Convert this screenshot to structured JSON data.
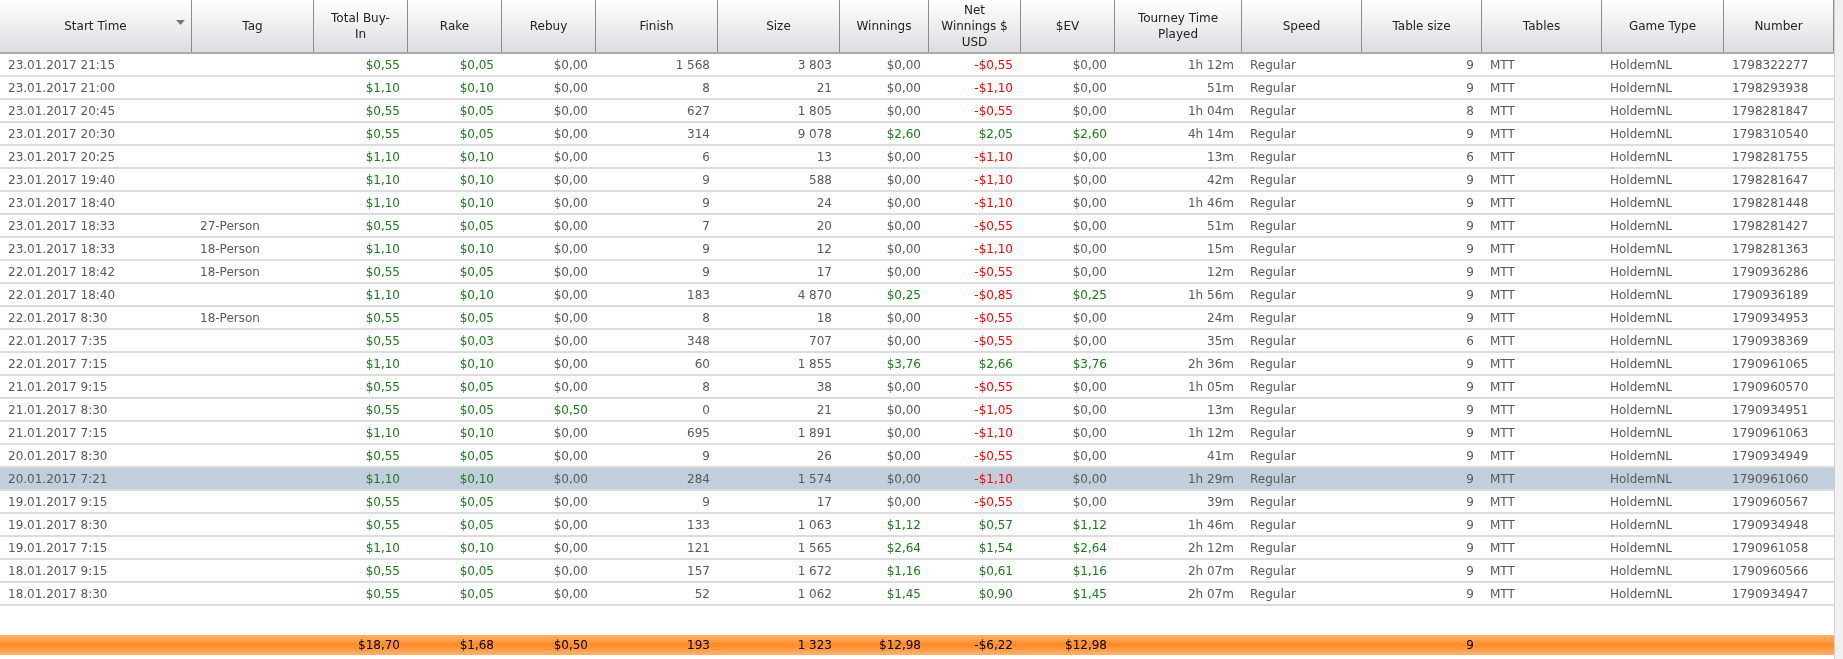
{
  "columns": [
    {
      "label": "Start Time",
      "sorted": true
    },
    {
      "label": "Tag",
      "sorted": false
    },
    {
      "label": "Total Buy-In",
      "sorted": false
    },
    {
      "label": "Rake",
      "sorted": false
    },
    {
      "label": "Rebuy",
      "sorted": false
    },
    {
      "label": "Finish",
      "sorted": false
    },
    {
      "label": "Size",
      "sorted": false
    },
    {
      "label": "Winnings",
      "sorted": false
    },
    {
      "label": "Net Winnings $ USD",
      "sorted": false
    },
    {
      "label": "$EV",
      "sorted": false
    },
    {
      "label": "Tourney Time Played",
      "sorted": false
    },
    {
      "label": "Speed",
      "sorted": false
    },
    {
      "label": "Table size",
      "sorted": false
    },
    {
      "label": "Tables",
      "sorted": false
    },
    {
      "label": "Game Type",
      "sorted": false
    },
    {
      "label": "Number",
      "sorted": false
    }
  ],
  "rows": [
    {
      "selected": false,
      "start_time": "23.01.2017 21:15",
      "buy_in": {
        "text": "$0,55",
        "color": "#1a7a1a"
      },
      "rake": {
        "text": "$0,05",
        "color": "#1a7a1a"
      },
      "rebuy": {
        "text": "$0,00",
        "color": "#595959"
      },
      "finish": "1 568",
      "size": "3 803",
      "winnings": {
        "text": "$0,00",
        "color": "#595959"
      },
      "net_winnings": {
        "text": "-$0,55",
        "color": "#ff0000"
      },
      "ev": {
        "text": "$0,00",
        "color": "#595959"
      },
      "time_played": "1h 12m",
      "speed": "Regular",
      "table_size": "9",
      "tables": "MTT",
      "game_type": "HoldemNL",
      "number": "1798322277"
    },
    {
      "selected": false,
      "start_time": "23.01.2017 21:00",
      "buy_in": {
        "text": "$1,10",
        "color": "#1a7a1a"
      },
      "rake": {
        "text": "$0,10",
        "color": "#1a7a1a"
      },
      "rebuy": {
        "text": "$0,00",
        "color": "#595959"
      },
      "finish": "8",
      "size": "21",
      "winnings": {
        "text": "$0,00",
        "color": "#595959"
      },
      "net_winnings": {
        "text": "-$1,10",
        "color": "#ff0000"
      },
      "ev": {
        "text": "$0,00",
        "color": "#595959"
      },
      "time_played": "51m",
      "speed": "Regular",
      "table_size": "9",
      "tables": "MTT",
      "game_type": "HoldemNL",
      "number": "1798293938"
    },
    {
      "selected": false,
      "start_time": "23.01.2017 20:45",
      "buy_in": {
        "text": "$0,55",
        "color": "#1a7a1a"
      },
      "rake": {
        "text": "$0,05",
        "color": "#1a7a1a"
      },
      "rebuy": {
        "text": "$0,00",
        "color": "#595959"
      },
      "finish": "627",
      "size": "1 805",
      "winnings": {
        "text": "$0,00",
        "color": "#595959"
      },
      "net_winnings": {
        "text": "-$0,55",
        "color": "#ff0000"
      },
      "ev": {
        "text": "$0,00",
        "color": "#595959"
      },
      "time_played": "1h 04m",
      "speed": "Regular",
      "table_size": "8",
      "tables": "MTT",
      "game_type": "HoldemNL",
      "number": "1798281847"
    },
    {
      "selected": false,
      "start_time": "23.01.2017 20:30",
      "buy_in": {
        "text": "$0,55",
        "color": "#1a7a1a"
      },
      "rake": {
        "text": "$0,05",
        "color": "#1a7a1a"
      },
      "rebuy": {
        "text": "$0,00",
        "color": "#595959"
      },
      "finish": "314",
      "size": "9 078",
      "winnings": {
        "text": "$2,60",
        "color": "#1a7a1a"
      },
      "net_winnings": {
        "text": "$2,05",
        "color": "#1a7a1a"
      },
      "ev": {
        "text": "$2,60",
        "color": "#1a7a1a"
      },
      "time_played": "4h 14m",
      "speed": "Regular",
      "table_size": "9",
      "tables": "MTT",
      "game_type": "HoldemNL",
      "number": "1798310540"
    },
    {
      "selected": false,
      "start_time": "23.01.2017 20:25",
      "buy_in": {
        "text": "$1,10",
        "color": "#1a7a1a"
      },
      "rake": {
        "text": "$0,10",
        "color": "#1a7a1a"
      },
      "rebuy": {
        "text": "$0,00",
        "color": "#595959"
      },
      "finish": "6",
      "size": "13",
      "winnings": {
        "text": "$0,00",
        "color": "#595959"
      },
      "net_winnings": {
        "text": "-$1,10",
        "color": "#ff0000"
      },
      "ev": {
        "text": "$0,00",
        "color": "#595959"
      },
      "time_played": "13m",
      "speed": "Regular",
      "table_size": "6",
      "tables": "MTT",
      "game_type": "HoldemNL",
      "number": "1798281755"
    },
    {
      "selected": false,
      "start_time": "23.01.2017 19:40",
      "buy_in": {
        "text": "$1,10",
        "color": "#1a7a1a"
      },
      "rake": {
        "text": "$0,10",
        "color": "#1a7a1a"
      },
      "rebuy": {
        "text": "$0,00",
        "color": "#595959"
      },
      "finish": "9",
      "size": "588",
      "winnings": {
        "text": "$0,00",
        "color": "#595959"
      },
      "net_winnings": {
        "text": "-$1,10",
        "color": "#ff0000"
      },
      "ev": {
        "text": "$0,00",
        "color": "#595959"
      },
      "time_played": "42m",
      "speed": "Regular",
      "table_size": "9",
      "tables": "MTT",
      "game_type": "HoldemNL",
      "number": "1798281647"
    },
    {
      "selected": false,
      "start_time": "23.01.2017 18:40",
      "buy_in": {
        "text": "$1,10",
        "color": "#1a7a1a"
      },
      "rake": {
        "text": "$0,10",
        "color": "#1a7a1a"
      },
      "rebuy": {
        "text": "$0,00",
        "color": "#595959"
      },
      "finish": "9",
      "size": "24",
      "winnings": {
        "text": "$0,00",
        "color": "#595959"
      },
      "net_winnings": {
        "text": "-$1,10",
        "color": "#ff0000"
      },
      "ev": {
        "text": "$0,00",
        "color": "#595959"
      },
      "time_played": "1h 46m",
      "speed": "Regular",
      "table_size": "9",
      "tables": "MTT",
      "game_type": "HoldemNL",
      "number": "1798281448"
    },
    {
      "selected": false,
      "start_time": "23.01.2017 18:33",
      "tag": "27-Person",
      "buy_in": {
        "text": "$0,55",
        "color": "#1a7a1a"
      },
      "rake": {
        "text": "$0,05",
        "color": "#1a7a1a"
      },
      "rebuy": {
        "text": "$0,00",
        "color": "#595959"
      },
      "finish": "7",
      "size": "20",
      "winnings": {
        "text": "$0,00",
        "color": "#595959"
      },
      "net_winnings": {
        "text": "-$0,55",
        "color": "#ff0000"
      },
      "ev": {
        "text": "$0,00",
        "color": "#595959"
      },
      "time_played": "51m",
      "speed": "Regular",
      "table_size": "9",
      "tables": "MTT",
      "game_type": "HoldemNL",
      "number": "1798281427"
    },
    {
      "selected": false,
      "start_time": "23.01.2017 18:33",
      "tag": "18-Person",
      "buy_in": {
        "text": "$1,10",
        "color": "#1a7a1a"
      },
      "rake": {
        "text": "$0,10",
        "color": "#1a7a1a"
      },
      "rebuy": {
        "text": "$0,00",
        "color": "#595959"
      },
      "finish": "9",
      "size": "12",
      "winnings": {
        "text": "$0,00",
        "color": "#595959"
      },
      "net_winnings": {
        "text": "-$1,10",
        "color": "#ff0000"
      },
      "ev": {
        "text": "$0,00",
        "color": "#595959"
      },
      "time_played": "15m",
      "speed": "Regular",
      "table_size": "9",
      "tables": "MTT",
      "game_type": "HoldemNL",
      "number": "1798281363"
    },
    {
      "selected": false,
      "start_time": "22.01.2017 18:42",
      "tag": "18-Person",
      "buy_in": {
        "text": "$0,55",
        "color": "#1a7a1a"
      },
      "rake": {
        "text": "$0,05",
        "color": "#1a7a1a"
      },
      "rebuy": {
        "text": "$0,00",
        "color": "#595959"
      },
      "finish": "9",
      "size": "17",
      "winnings": {
        "text": "$0,00",
        "color": "#595959"
      },
      "net_winnings": {
        "text": "-$0,55",
        "color": "#ff0000"
      },
      "ev": {
        "text": "$0,00",
        "color": "#595959"
      },
      "time_played": "12m",
      "speed": "Regular",
      "table_size": "9",
      "tables": "MTT",
      "game_type": "HoldemNL",
      "number": "1790936286"
    },
    {
      "selected": false,
      "start_time": "22.01.2017 18:40",
      "buy_in": {
        "text": "$1,10",
        "color": "#1a7a1a"
      },
      "rake": {
        "text": "$0,10",
        "color": "#1a7a1a"
      },
      "rebuy": {
        "text": "$0,00",
        "color": "#595959"
      },
      "finish": "183",
      "size": "4 870",
      "winnings": {
        "text": "$0,25",
        "color": "#1a7a1a"
      },
      "net_winnings": {
        "text": "-$0,85",
        "color": "#ff0000"
      },
      "ev": {
        "text": "$0,25",
        "color": "#1a7a1a"
      },
      "time_played": "1h 56m",
      "speed": "Regular",
      "table_size": "9",
      "tables": "MTT",
      "game_type": "HoldemNL",
      "number": "1790936189"
    },
    {
      "selected": false,
      "start_time": "22.01.2017 8:30",
      "tag": "18-Person",
      "buy_in": {
        "text": "$0,55",
        "color": "#1a7a1a"
      },
      "rake": {
        "text": "$0,05",
        "color": "#1a7a1a"
      },
      "rebuy": {
        "text": "$0,00",
        "color": "#595959"
      },
      "finish": "8",
      "size": "18",
      "winnings": {
        "text": "$0,00",
        "color": "#595959"
      },
      "net_winnings": {
        "text": "-$0,55",
        "color": "#ff0000"
      },
      "ev": {
        "text": "$0,00",
        "color": "#595959"
      },
      "time_played": "24m",
      "speed": "Regular",
      "table_size": "9",
      "tables": "MTT",
      "game_type": "HoldemNL",
      "number": "1790934953"
    },
    {
      "selected": false,
      "start_time": "22.01.2017 7:35",
      "buy_in": {
        "text": "$0,55",
        "color": "#1a7a1a"
      },
      "rake": {
        "text": "$0,03",
        "color": "#1a7a1a"
      },
      "rebuy": {
        "text": "$0,00",
        "color": "#595959"
      },
      "finish": "348",
      "size": "707",
      "winnings": {
        "text": "$0,00",
        "color": "#595959"
      },
      "net_winnings": {
        "text": "-$0,55",
        "color": "#ff0000"
      },
      "ev": {
        "text": "$0,00",
        "color": "#595959"
      },
      "time_played": "35m",
      "speed": "Regular",
      "table_size": "6",
      "tables": "MTT",
      "game_type": "HoldemNL",
      "number": "1790938369"
    },
    {
      "selected": false,
      "start_time": "22.01.2017 7:15",
      "buy_in": {
        "text": "$1,10",
        "color": "#1a7a1a"
      },
      "rake": {
        "text": "$0,10",
        "color": "#1a7a1a"
      },
      "rebuy": {
        "text": "$0,00",
        "color": "#595959"
      },
      "finish": "60",
      "size": "1 855",
      "winnings": {
        "text": "$3,76",
        "color": "#1a7a1a"
      },
      "net_winnings": {
        "text": "$2,66",
        "color": "#1a7a1a"
      },
      "ev": {
        "text": "$3,76",
        "color": "#1a7a1a"
      },
      "time_played": "2h 36m",
      "speed": "Regular",
      "table_size": "9",
      "tables": "MTT",
      "game_type": "HoldemNL",
      "number": "1790961065"
    },
    {
      "selected": false,
      "start_time": "21.01.2017 9:15",
      "buy_in": {
        "text": "$0,55",
        "color": "#1a7a1a"
      },
      "rake": {
        "text": "$0,05",
        "color": "#1a7a1a"
      },
      "rebuy": {
        "text": "$0,00",
        "color": "#595959"
      },
      "finish": "8",
      "size": "38",
      "winnings": {
        "text": "$0,00",
        "color": "#595959"
      },
      "net_winnings": {
        "text": "-$0,55",
        "color": "#ff0000"
      },
      "ev": {
        "text": "$0,00",
        "color": "#595959"
      },
      "time_played": "1h 05m",
      "speed": "Regular",
      "table_size": "9",
      "tables": "MTT",
      "game_type": "HoldemNL",
      "number": "1790960570"
    },
    {
      "selected": false,
      "start_time": "21.01.2017 8:30",
      "buy_in": {
        "text": "$0,55",
        "color": "#1a7a1a"
      },
      "rake": {
        "text": "$0,05",
        "color": "#1a7a1a"
      },
      "rebuy": {
        "text": "$0,50",
        "color": "#1a7a1a"
      },
      "finish": "0",
      "size": "21",
      "winnings": {
        "text": "$0,00",
        "color": "#595959"
      },
      "net_winnings": {
        "text": "-$1,05",
        "color": "#ff0000"
      },
      "ev": {
        "text": "$0,00",
        "color": "#595959"
      },
      "time_played": "13m",
      "speed": "Regular",
      "table_size": "9",
      "tables": "MTT",
      "game_type": "HoldemNL",
      "number": "1790934951"
    },
    {
      "selected": false,
      "start_time": "21.01.2017 7:15",
      "buy_in": {
        "text": "$1,10",
        "color": "#1a7a1a"
      },
      "rake": {
        "text": "$0,10",
        "color": "#1a7a1a"
      },
      "rebuy": {
        "text": "$0,00",
        "color": "#595959"
      },
      "finish": "695",
      "size": "1 891",
      "winnings": {
        "text": "$0,00",
        "color": "#595959"
      },
      "net_winnings": {
        "text": "-$1,10",
        "color": "#ff0000"
      },
      "ev": {
        "text": "$0,00",
        "color": "#595959"
      },
      "time_played": "1h 12m",
      "speed": "Regular",
      "table_size": "9",
      "tables": "MTT",
      "game_type": "HoldemNL",
      "number": "1790961063"
    },
    {
      "selected": false,
      "start_time": "20.01.2017 8:30",
      "buy_in": {
        "text": "$0,55",
        "color": "#1a7a1a"
      },
      "rake": {
        "text": "$0,05",
        "color": "#1a7a1a"
      },
      "rebuy": {
        "text": "$0,00",
        "color": "#595959"
      },
      "finish": "9",
      "size": "26",
      "winnings": {
        "text": "$0,00",
        "color": "#595959"
      },
      "net_winnings": {
        "text": "-$0,55",
        "color": "#ff0000"
      },
      "ev": {
        "text": "$0,00",
        "color": "#595959"
      },
      "time_played": "41m",
      "speed": "Regular",
      "table_size": "9",
      "tables": "MTT",
      "game_type": "HoldemNL",
      "number": "1790934949"
    },
    {
      "selected": true,
      "start_time": "20.01.2017 7:21",
      "buy_in": {
        "text": "$1,10",
        "color": "#1a7a1a"
      },
      "rake": {
        "text": "$0,10",
        "color": "#1a7a1a"
      },
      "rebuy": {
        "text": "$0,00",
        "color": "#595959"
      },
      "finish": "284",
      "size": "1 574",
      "winnings": {
        "text": "$0,00",
        "color": "#595959"
      },
      "net_winnings": {
        "text": "-$1,10",
        "color": "#ff0000"
      },
      "ev": {
        "text": "$0,00",
        "color": "#595959"
      },
      "time_played": "1h 29m",
      "speed": "Regular",
      "table_size": "9",
      "tables": "MTT",
      "game_type": "HoldemNL",
      "number": "1790961060"
    },
    {
      "selected": false,
      "start_time": "19.01.2017 9:15",
      "buy_in": {
        "text": "$0,55",
        "color": "#1a7a1a"
      },
      "rake": {
        "text": "$0,05",
        "color": "#1a7a1a"
      },
      "rebuy": {
        "text": "$0,00",
        "color": "#595959"
      },
      "finish": "9",
      "size": "17",
      "winnings": {
        "text": "$0,00",
        "color": "#595959"
      },
      "net_winnings": {
        "text": "-$0,55",
        "color": "#ff0000"
      },
      "ev": {
        "text": "$0,00",
        "color": "#595959"
      },
      "time_played": "39m",
      "speed": "Regular",
      "table_size": "9",
      "tables": "MTT",
      "game_type": "HoldemNL",
      "number": "1790960567"
    },
    {
      "selected": false,
      "start_time": "19.01.2017 8:30",
      "buy_in": {
        "text": "$0,55",
        "color": "#1a7a1a"
      },
      "rake": {
        "text": "$0,05",
        "color": "#1a7a1a"
      },
      "rebuy": {
        "text": "$0,00",
        "color": "#595959"
      },
      "finish": "133",
      "size": "1 063",
      "winnings": {
        "text": "$1,12",
        "color": "#1a7a1a"
      },
      "net_winnings": {
        "text": "$0,57",
        "color": "#1a7a1a"
      },
      "ev": {
        "text": "$1,12",
        "color": "#1a7a1a"
      },
      "time_played": "1h 46m",
      "speed": "Regular",
      "table_size": "9",
      "tables": "MTT",
      "game_type": "HoldemNL",
      "number": "1790934948"
    },
    {
      "selected": false,
      "start_time": "19.01.2017 7:15",
      "buy_in": {
        "text": "$1,10",
        "color": "#1a7a1a"
      },
      "rake": {
        "text": "$0,10",
        "color": "#1a7a1a"
      },
      "rebuy": {
        "text": "$0,00",
        "color": "#595959"
      },
      "finish": "121",
      "size": "1 565",
      "winnings": {
        "text": "$2,64",
        "color": "#1a7a1a"
      },
      "net_winnings": {
        "text": "$1,54",
        "color": "#1a7a1a"
      },
      "ev": {
        "text": "$2,64",
        "color": "#1a7a1a"
      },
      "time_played": "2h 12m",
      "speed": "Regular",
      "table_size": "9",
      "tables": "MTT",
      "game_type": "HoldemNL",
      "number": "1790961058"
    },
    {
      "selected": false,
      "start_time": "18.01.2017 9:15",
      "buy_in": {
        "text": "$0,55",
        "color": "#1a7a1a"
      },
      "rake": {
        "text": "$0,05",
        "color": "#1a7a1a"
      },
      "rebuy": {
        "text": "$0,00",
        "color": "#595959"
      },
      "finish": "157",
      "size": "1 672",
      "winnings": {
        "text": "$1,16",
        "color": "#1a7a1a"
      },
      "net_winnings": {
        "text": "$0,61",
        "color": "#1a7a1a"
      },
      "ev": {
        "text": "$1,16",
        "color": "#1a7a1a"
      },
      "time_played": "2h 07m",
      "speed": "Regular",
      "table_size": "9",
      "tables": "MTT",
      "game_type": "HoldemNL",
      "number": "1790960566"
    },
    {
      "selected": false,
      "start_time": "18.01.2017 8:30",
      "buy_in": {
        "text": "$0,55",
        "color": "#1a7a1a"
      },
      "rake": {
        "text": "$0,05",
        "color": "#1a7a1a"
      },
      "rebuy": {
        "text": "$0,00",
        "color": "#595959"
      },
      "finish": "52",
      "size": "1 062",
      "winnings": {
        "text": "$1,45",
        "color": "#1a7a1a"
      },
      "net_winnings": {
        "text": "$0,90",
        "color": "#1a7a1a"
      },
      "ev": {
        "text": "$1,45",
        "color": "#1a7a1a"
      },
      "time_played": "2h 07m",
      "speed": "Regular",
      "table_size": "9",
      "tables": "MTT",
      "game_type": "HoldemNL",
      "number": "1790934947"
    }
  ],
  "totals": {
    "buy_in": "$18,70",
    "rake": "$1,68",
    "rebuy": "$0,50",
    "finish": "193",
    "size": "1 323",
    "winnings": "$12,98",
    "net_winnings": "-$6,22",
    "ev": "$12,98",
    "table_size": "9"
  }
}
